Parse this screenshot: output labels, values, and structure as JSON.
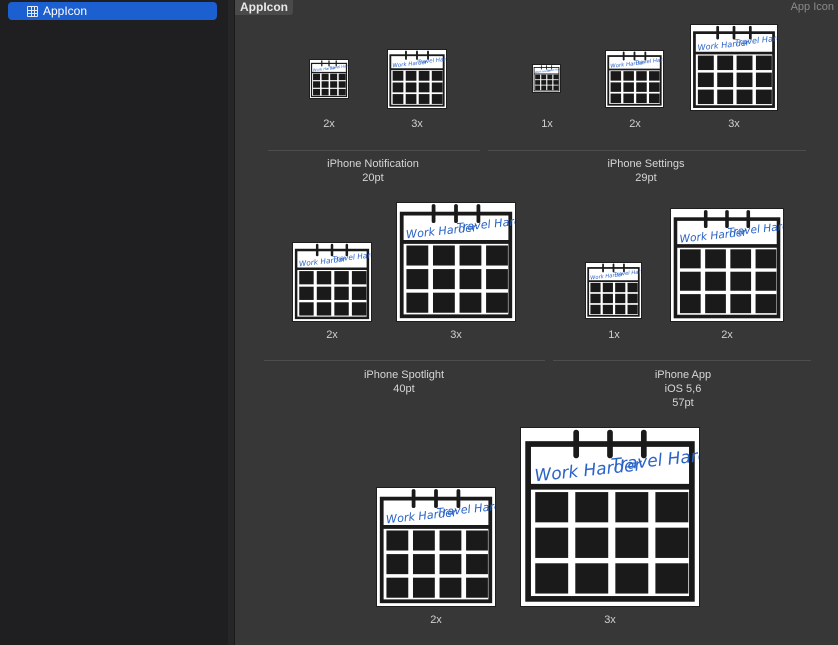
{
  "sidebar": {
    "items": [
      {
        "label": "AppIcon",
        "icon": "asset-catalog-icon",
        "selected": true
      }
    ]
  },
  "header": {
    "title": "AppIcon",
    "type_label": "App Icon"
  },
  "icon_art": {
    "banner_left": "Work Harder",
    "banner_right": "Travel Harder",
    "ink_color": "#1a1a1a",
    "text_color": "#2a63c7"
  },
  "groups": [
    {
      "name": "iPhone Notification",
      "size": "20pt",
      "slots": [
        {
          "scale": "2x"
        },
        {
          "scale": "3x"
        }
      ]
    },
    {
      "name": "iPhone Settings",
      "size": "29pt",
      "slots": [
        {
          "scale": "1x"
        },
        {
          "scale": "2x"
        },
        {
          "scale": "3x"
        }
      ]
    },
    {
      "name": "iPhone Spotlight",
      "size": "40pt",
      "slots": [
        {
          "scale": "2x"
        },
        {
          "scale": "3x"
        }
      ]
    },
    {
      "name": "iPhone App",
      "os": "iOS 5,6",
      "size": "57pt",
      "slots": [
        {
          "scale": "1x"
        },
        {
          "scale": "2x"
        }
      ]
    },
    {
      "name": "",
      "size": "",
      "slots": [
        {
          "scale": "2x"
        },
        {
          "scale": "3x"
        }
      ]
    }
  ]
}
